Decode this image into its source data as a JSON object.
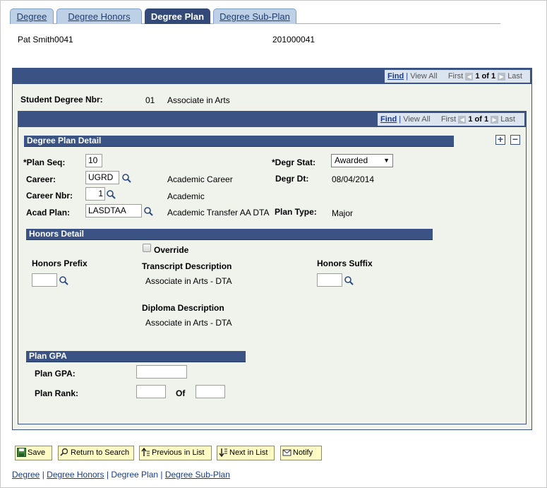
{
  "tabs": [
    "Degree",
    "Degree Honors",
    "Degree Plan",
    "Degree Sub-Plan"
  ],
  "header": {
    "name": "Pat Smith0041",
    "id": "201000041"
  },
  "nav": {
    "find": "Find",
    "view_all": "View All",
    "first": "First",
    "count": "1 of 1",
    "last": "Last"
  },
  "student": {
    "label": "Student Degree Nbr:",
    "nbr": "01",
    "desc": "Associate in Arts"
  },
  "plan_detail": {
    "title": "Degree Plan Detail",
    "plan_seq_label": "*Plan Seq:",
    "plan_seq": "10",
    "career_label": "Career:",
    "career": "UGRD",
    "career_desc": "Academic Career",
    "career_nbr_label": "Career Nbr:",
    "career_nbr": "1",
    "career_nbr_desc": "Academic",
    "acad_plan_label": "Acad Plan:",
    "acad_plan": "LASDTAA",
    "acad_plan_desc": "Academic Transfer AA DTA",
    "degr_stat_label": "*Degr Stat:",
    "degr_stat": "Awarded",
    "degr_dt_label": "Degr Dt:",
    "degr_dt": "08/04/2014",
    "plan_type_label": "Plan Type:",
    "plan_type": "Major"
  },
  "honors": {
    "title": "Honors Detail",
    "override_label": "Override",
    "prefix_label": "Honors Prefix",
    "transcript_label": "Transcript Description",
    "transcript_value": "Associate in Arts - DTA",
    "suffix_label": "Honors Suffix",
    "diploma_label": "Diploma Description",
    "diploma_value": "Associate in Arts - DTA"
  },
  "gpa": {
    "title": "Plan GPA",
    "gpa_label": "Plan GPA:",
    "rank_label": "Plan Rank:",
    "of_label": "Of"
  },
  "toolbar": {
    "save": "Save",
    "return": "Return to Search",
    "prev": "Previous in List",
    "next": "Next in List",
    "notify": "Notify"
  },
  "footer": {
    "links": [
      "Degree",
      "Degree Honors",
      "Degree Plan",
      "Degree Sub-Plan"
    ],
    "separator": " | "
  },
  "colors": {
    "accent": "#3b5384",
    "tab": "#bdd0e6",
    "button": "#fefcc4"
  }
}
